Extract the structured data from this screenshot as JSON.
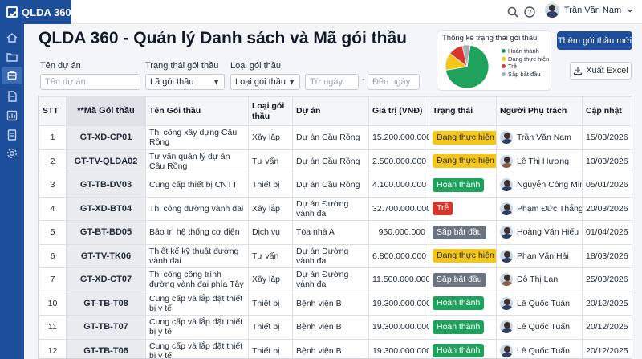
{
  "app": {
    "name": "QLDA 360"
  },
  "user": {
    "name": "Trần Văn Nam"
  },
  "page": {
    "title": "QLDA 360 - Quản lý Danh sách và Mã gói thầu"
  },
  "filters": {
    "project_label": "Tên dự án",
    "project_placeholder": "Tên dự án",
    "status_label": "Trạng thái gói thầu",
    "status_value": "Lã gói thầu",
    "type_label": "Loại gói thầu",
    "type_value": "Loại gói thầu",
    "from_placeholder": "Từ ngày",
    "to_placeholder": "Đến ngày",
    "separator": "-"
  },
  "actions": {
    "add_label": "Thêm gói thầu mới",
    "export_label": "Xuất Excel"
  },
  "chart_data": {
    "type": "pie",
    "title": "Thống kê trạng thái gói thầu",
    "categories": [
      "Hoàn thành",
      "Đang thực hiện",
      "Trễ",
      "Sắp bắt đầu"
    ],
    "values": [
      70,
      13,
      11,
      6
    ],
    "colors": [
      "#1fa35c",
      "#f5c518",
      "#d9362b",
      "#a9adb3"
    ]
  },
  "table": {
    "headers": [
      "STT",
      "**Mã Gói thầu",
      "Tên Gói thầu",
      "Loại gói thầu",
      "Dự án",
      "Giá trị (VNĐ)",
      "Trạng thái",
      "Người Phụ trách",
      "Cập nhật"
    ],
    "rows": [
      {
        "stt": "1",
        "code": "GT-XD-CP01",
        "name": "Thi công xây dựng Cầu Rồng",
        "type": "Xây lắp",
        "project": "Dự án Cầu Rồng",
        "value": "15.200.000.000",
        "status": "Đang thực hiện",
        "status_kind": "yellow",
        "owner": "Trần Văn Nam",
        "gender": "m",
        "updated": "15/03/2026"
      },
      {
        "stt": "2",
        "code": "GT-TV-QLDA02",
        "name": "Tư vấn quản lý dự án Cầu Rồng",
        "type": "Tư vấn",
        "project": "Dự án Cầu Rồng",
        "value": "2.500.000.000",
        "status": "Đang thực hiện",
        "status_kind": "yellow",
        "owner": "Lê Thị Hương",
        "gender": "f",
        "updated": "10/03/2026"
      },
      {
        "stt": "3",
        "code": "GT-TB-DV03",
        "name": "Cung cấp thiết bị CNTT",
        "type": "Thiết bị",
        "project": "Dự án Cầu Rồng",
        "value": "4.100.000.000",
        "status": "Hoàn thành",
        "status_kind": "green",
        "owner": "Nguyễn Công Minh",
        "gender": "m",
        "updated": "05/01/2026"
      },
      {
        "stt": "4",
        "code": "GT-XD-BT04",
        "name": "Thi công đường vành đai",
        "type": "Xây lắp",
        "project": "Dự án Đường vành đai",
        "value": "32.700.000.000",
        "status": "Trễ",
        "status_kind": "red",
        "owner": "Phạm Đức Thắng",
        "gender": "m",
        "updated": "20/03/2026"
      },
      {
        "stt": "5",
        "code": "GT-BT-BD05",
        "name": "Bảo trì hệ thống cơ điện",
        "type": "Dịch vụ",
        "project": "Tòa nhà A",
        "value": "950.000.000",
        "status": "Sắp bắt đầu",
        "status_kind": "gray",
        "owner": "Hoàng Văn Hiếu",
        "gender": "m",
        "updated": "01/04/2026"
      },
      {
        "stt": "6",
        "code": "GT-TV-TK06",
        "name": "Thiết kế kỹ thuật đường vành đai",
        "type": "Tư vấn",
        "project": "Dự án Đường vành đai",
        "value": "6.800.000.000",
        "status": "Đang thực hiện",
        "status_kind": "yellow",
        "owner": "Phan Văn Hải",
        "gender": "m",
        "updated": "18/03/2026"
      },
      {
        "stt": "7",
        "code": "GT-XD-CT07",
        "name": "Thi công công trình đường vành đai phía Tây",
        "type": "Xây lắp",
        "project": "Dự án Đường vành đai",
        "value": "11.500.000.000",
        "status": "Sắp bắt đầu",
        "status_kind": "gray",
        "owner": "Đỗ Thị Lan",
        "gender": "f",
        "updated": "25/03/2026"
      },
      {
        "stt": "10",
        "code": "GT-TB-T08",
        "name": "Cung cấp và lắp đặt thiết bị y tế",
        "type": "Thiết bị",
        "project": "Bệnh viện B",
        "value": "19.300.000.000",
        "status": "Hoàn thành",
        "status_kind": "green",
        "owner": "Lê Quốc Tuấn",
        "gender": "m",
        "updated": "20/12/2025"
      },
      {
        "stt": "11",
        "code": "GT-TB-T07",
        "name": "Cung cấp và lắp đặt thiết bị y tế",
        "type": "Thiết bị",
        "project": "Bệnh viện B",
        "value": "19.300.000.000",
        "status": "Hoàn thành",
        "status_kind": "green",
        "owner": "Lê Quốc Tuấn",
        "gender": "m",
        "updated": "20/12/2025"
      },
      {
        "stt": "12",
        "code": "GT-TB-T06",
        "name": "Cung cấp và lắp đặt thiết bị y tế",
        "type": "Thiết bị",
        "project": "Bệnh viện B",
        "value": "19.300.000.000",
        "status": "Hoàn thành",
        "status_kind": "green",
        "owner": "Lê Quốc Tuấn",
        "gender": "m",
        "updated": "20/12/2025"
      }
    ]
  },
  "icons": {
    "sidebar": [
      "home-icon",
      "folder-icon",
      "package-icon",
      "file-icon",
      "chart-icon",
      "document-icon",
      "settings-icon"
    ],
    "topbar": [
      "search-icon",
      "help-icon",
      "chevron-down-icon"
    ]
  }
}
